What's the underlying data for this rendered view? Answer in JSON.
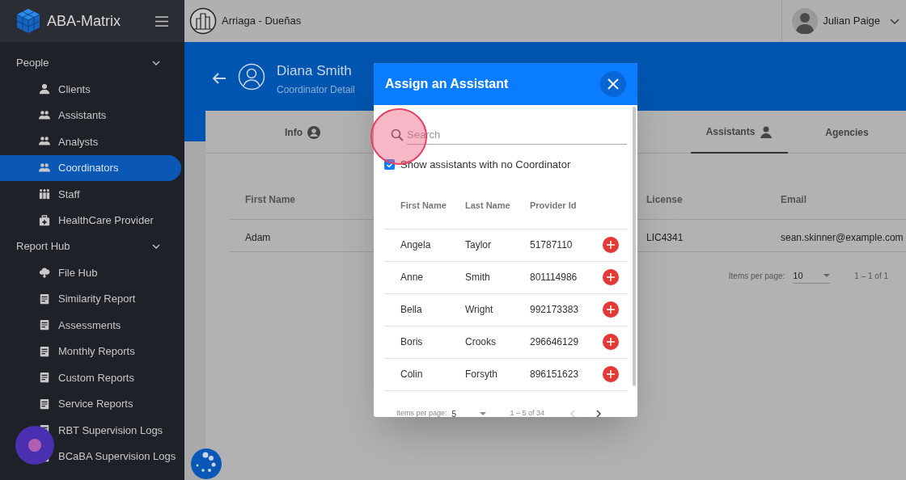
{
  "app": {
    "name": "ABA-Matrix"
  },
  "topbar": {
    "organization": "Arriaga - Dueñas",
    "user": "Julian Paige"
  },
  "sidebar": {
    "sections": [
      {
        "label": "People",
        "expanded": true,
        "items": [
          {
            "label": "Clients",
            "kind": "person",
            "selected": false
          },
          {
            "label": "Assistants",
            "kind": "group",
            "selected": false
          },
          {
            "label": "Analysts",
            "kind": "group",
            "selected": false
          },
          {
            "label": "Coordinators",
            "kind": "group",
            "selected": true
          },
          {
            "label": "Staff",
            "kind": "staff",
            "selected": false
          },
          {
            "label": "HealthCare Provider",
            "kind": "kit",
            "selected": false
          }
        ]
      },
      {
        "label": "Report Hub",
        "expanded": true,
        "items": [
          {
            "label": "File Hub",
            "kind": "cloud",
            "selected": false
          },
          {
            "label": "Similarity Report",
            "kind": "doc",
            "selected": false
          },
          {
            "label": "Assessments",
            "kind": "doc",
            "selected": false
          },
          {
            "label": "Monthly Reports",
            "kind": "doc",
            "selected": false
          },
          {
            "label": "Custom Reports",
            "kind": "doc",
            "selected": false
          },
          {
            "label": "Service Reports",
            "kind": "doc",
            "selected": false
          },
          {
            "label": "RBT Supervision Logs",
            "kind": "doc",
            "selected": false
          },
          {
            "label": "BCaBA Supervision Logs",
            "kind": "doc",
            "selected": false
          }
        ]
      }
    ]
  },
  "header": {
    "name": "Diana Smith",
    "subtitle": "Coordinator Detail"
  },
  "tabs": [
    {
      "label": "Info",
      "selected": false
    },
    {
      "label": "Assistants",
      "selected": true
    },
    {
      "label": "Agencies",
      "selected": false
    }
  ],
  "table": {
    "columns": [
      {
        "label": "First Name"
      },
      {
        "label": "License"
      },
      {
        "label": "Email"
      }
    ],
    "rows": [
      [
        "Adam",
        "LIC4341",
        "sean.skinner@example.com"
      ]
    ],
    "pagination": {
      "label": "Items per page:",
      "page_size": "10",
      "range": "1 – 1 of 1"
    }
  },
  "dialog": {
    "title": "Assign an Assistant",
    "search": {
      "placeholder": "Search"
    },
    "filter": {
      "label": "Show assistants with no Coordinator",
      "checked": true
    },
    "columns": [
      "First Name",
      "Last Name",
      "Provider Id"
    ],
    "rows": [
      [
        "Angela",
        "Taylor",
        "51787110"
      ],
      [
        "Anne",
        "Smith",
        "801114986"
      ],
      [
        "Bella",
        "Wright",
        "992173383"
      ],
      [
        "Boris",
        "Crooks",
        "296646129"
      ],
      [
        "Colin",
        "Forsyth",
        "896151623"
      ]
    ],
    "pagination": {
      "label": "Items per page:",
      "page_size": "5",
      "range": "1 – 5 of 34"
    }
  }
}
